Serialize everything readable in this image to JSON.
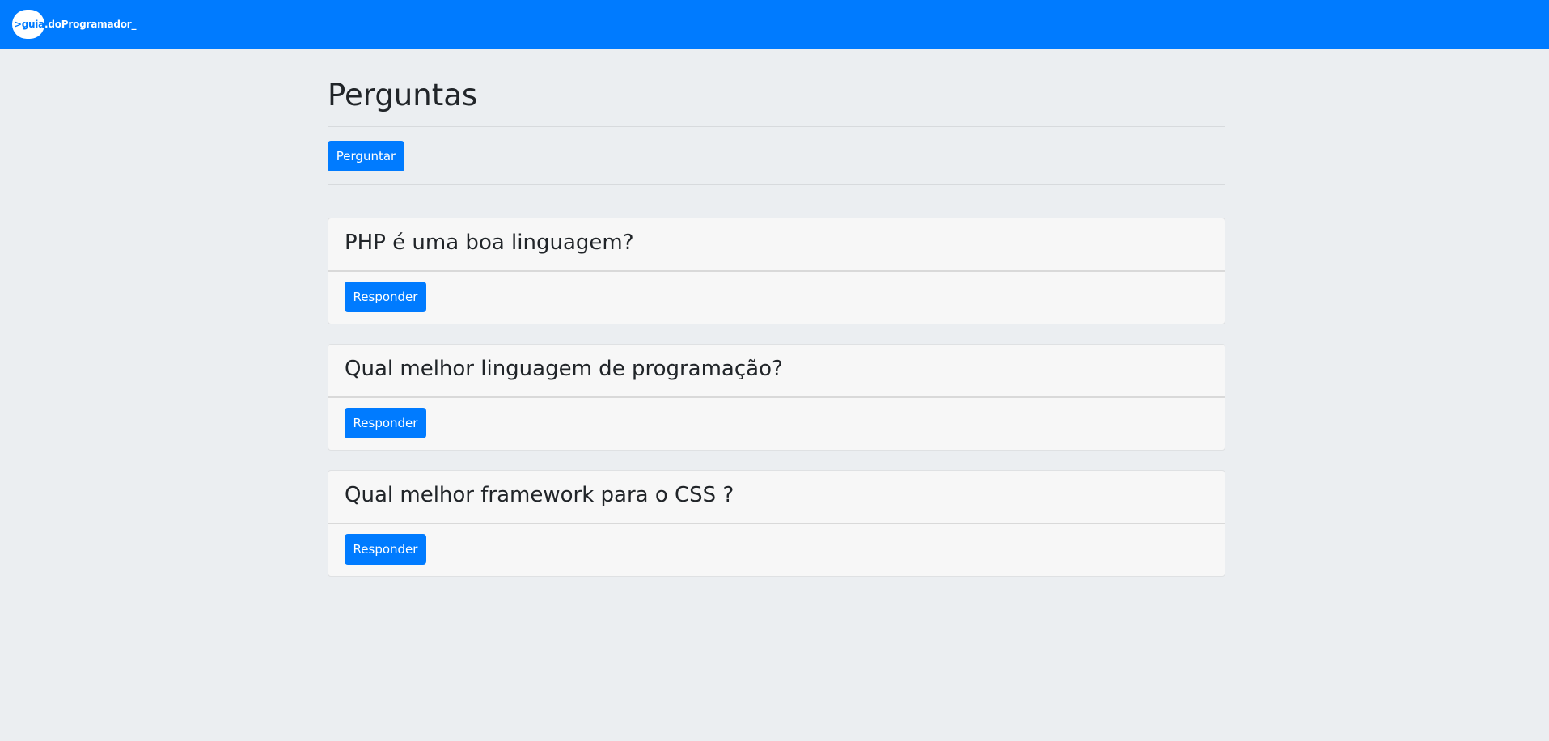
{
  "navbar": {
    "brand_prefix": ">guia",
    "brand_rest": ".doProgramador",
    "brand_cursor": "_"
  },
  "page": {
    "title": "Perguntas",
    "ask_button_label": "Perguntar"
  },
  "questions": [
    {
      "title": "PHP é uma boa linguagem?",
      "answer_label": "Responder"
    },
    {
      "title": "Qual melhor linguagem de programação?",
      "answer_label": "Responder"
    },
    {
      "title": "Qual melhor framework para o CSS ?",
      "answer_label": "Responder"
    }
  ],
  "colors": {
    "primary": "#007bff",
    "background": "#ebeef1",
    "card_background": "#f7f7f7"
  }
}
